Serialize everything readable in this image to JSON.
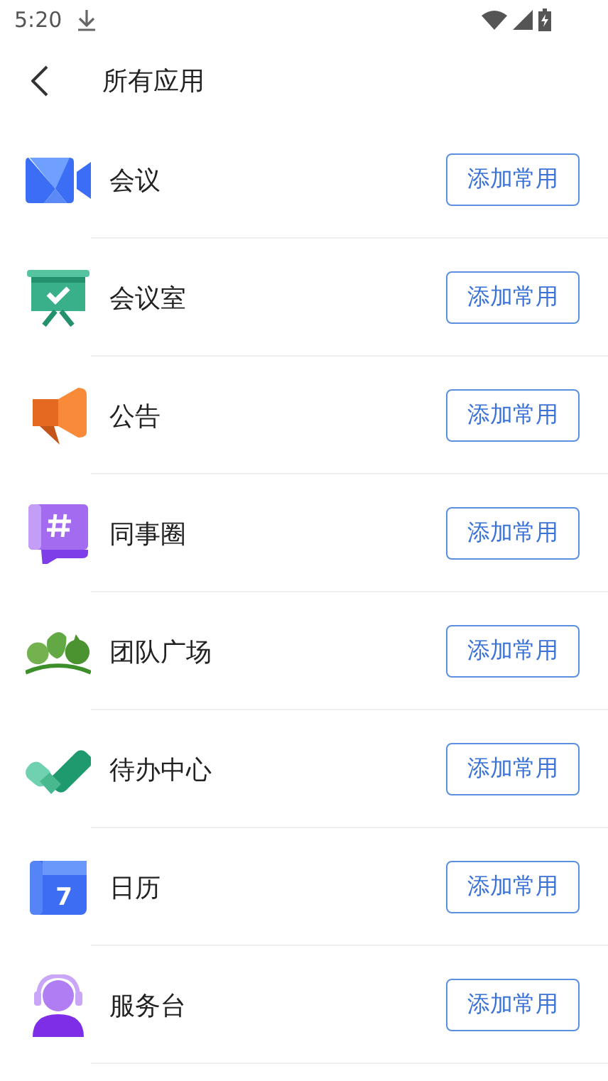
{
  "status_bar": {
    "time": "5:20"
  },
  "header": {
    "title": "所有应用"
  },
  "apps": [
    {
      "name": "会议",
      "kind": "video",
      "button": "添加常用"
    },
    {
      "name": "会议室",
      "kind": "board",
      "button": "添加常用"
    },
    {
      "name": "公告",
      "kind": "megaphone",
      "button": "添加常用"
    },
    {
      "name": "同事圈",
      "kind": "hash",
      "button": "添加常用"
    },
    {
      "name": "团队广场",
      "kind": "trees",
      "button": "添加常用"
    },
    {
      "name": "待办中心",
      "kind": "check",
      "button": "添加常用"
    },
    {
      "name": "日历",
      "kind": "calendar",
      "icon_label": "7",
      "button": "添加常用"
    },
    {
      "name": "服务台",
      "kind": "headset",
      "button": "添加常用"
    }
  ]
}
